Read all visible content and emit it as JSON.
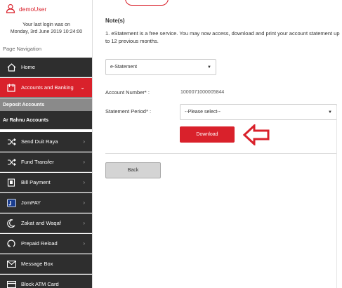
{
  "user": {
    "name": "demoUser",
    "last_login_line1": "Your last login was on",
    "last_login_line2": "Monday, 3rd June 2019 10:24:00"
  },
  "sidebar": {
    "heading": "Page Navigation",
    "items": [
      {
        "label": "Home",
        "icon": "home-icon"
      },
      {
        "label": "Accounts and Banking",
        "icon": "wallet-icon",
        "active": true
      },
      {
        "label": "Send Duit Raya",
        "icon": "shuffle-icon"
      },
      {
        "label": "Fund Transfer",
        "icon": "shuffle-icon"
      },
      {
        "label": "Bill Payment",
        "icon": "bill-icon"
      },
      {
        "label": "JomPAY",
        "icon": "jompay-icon"
      },
      {
        "label": "Zakat and Waqaf",
        "icon": "crescent-icon"
      },
      {
        "label": "Prepaid Reload",
        "icon": "reload-icon"
      },
      {
        "label": "Message Box",
        "icon": "envelope-icon"
      },
      {
        "label": "Block ATM Card",
        "icon": "card-icon"
      }
    ],
    "subitems": [
      {
        "label": "Deposit Accounts",
        "selected": true
      },
      {
        "label": "Ar Rahnu Accounts",
        "selected": false
      }
    ]
  },
  "main": {
    "note_title": "Note(s)",
    "note_text": "1. eStatement is a free service. You may now access, download and print your account statement up to 12 previous months.",
    "statement_type": "e-Statement",
    "account_number_label": "Account Number* :",
    "account_number_value": "1000071000005844",
    "statement_period_label": "Statement Period* :",
    "statement_period_placeholder": "--Please select--",
    "download_label": "Download",
    "back_label": "Back"
  },
  "colors": {
    "accent": "#d9212b",
    "nav_bg": "#2e2e2e",
    "sub_selected_bg": "#8a8a8a"
  }
}
